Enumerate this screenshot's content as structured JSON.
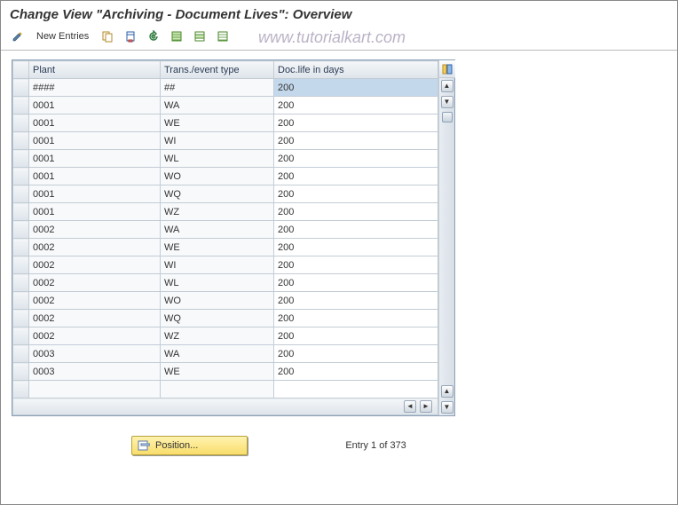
{
  "title": "Change View \"Archiving - Document Lives\": Overview",
  "watermark": "www.tutorialkart.com",
  "toolbar": {
    "new_entries_label": "New Entries"
  },
  "columns": {
    "plant": "Plant",
    "trans": "Trans./event type",
    "doclife": "Doc.life in days"
  },
  "rows": [
    {
      "plant": "####",
      "trans": "##",
      "doclife": "200",
      "sel": true
    },
    {
      "plant": "0001",
      "trans": "WA",
      "doclife": "200"
    },
    {
      "plant": "0001",
      "trans": "WE",
      "doclife": "200"
    },
    {
      "plant": "0001",
      "trans": "WI",
      "doclife": "200"
    },
    {
      "plant": "0001",
      "trans": "WL",
      "doclife": "200"
    },
    {
      "plant": "0001",
      "trans": "WO",
      "doclife": "200"
    },
    {
      "plant": "0001",
      "trans": "WQ",
      "doclife": "200"
    },
    {
      "plant": "0001",
      "trans": "WZ",
      "doclife": "200"
    },
    {
      "plant": "0002",
      "trans": "WA",
      "doclife": "200"
    },
    {
      "plant": "0002",
      "trans": "WE",
      "doclife": "200"
    },
    {
      "plant": "0002",
      "trans": "WI",
      "doclife": "200"
    },
    {
      "plant": "0002",
      "trans": "WL",
      "doclife": "200"
    },
    {
      "plant": "0002",
      "trans": "WO",
      "doclife": "200"
    },
    {
      "plant": "0002",
      "trans": "WQ",
      "doclife": "200"
    },
    {
      "plant": "0002",
      "trans": "WZ",
      "doclife": "200"
    },
    {
      "plant": "0003",
      "trans": "WA",
      "doclife": "200"
    },
    {
      "plant": "0003",
      "trans": "WE",
      "doclife": "200"
    }
  ],
  "footer": {
    "position_label": "Position...",
    "entry_text": "Entry 1 of 373"
  }
}
